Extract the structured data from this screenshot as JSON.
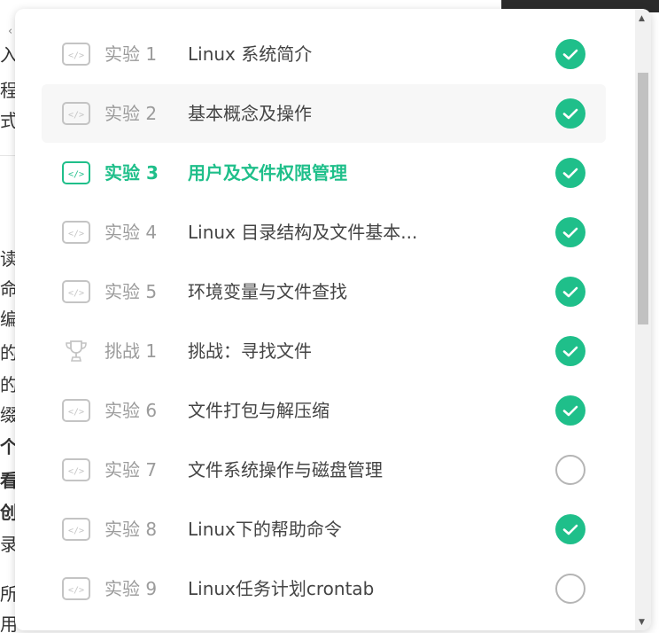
{
  "background": {
    "chars": [
      "入",
      "程",
      "式",
      "读",
      "命",
      "编",
      "的",
      "的",
      "缀",
      "个",
      "看",
      "创",
      "录",
      "所",
      "用"
    ]
  },
  "colors": {
    "accent": "#1fbf8a",
    "complete": "#1fbf8a",
    "incomplete": "#b5b5b5"
  },
  "lessons": [
    {
      "num": "实验 1",
      "title": "Linux 系统简介",
      "icon": "code-icon",
      "status": "complete",
      "active": false,
      "hover": false
    },
    {
      "num": "实验 2",
      "title": "基本概念及操作",
      "icon": "code-icon",
      "status": "complete",
      "active": false,
      "hover": true
    },
    {
      "num": "实验 3",
      "title": "用户及文件权限管理",
      "icon": "code-icon",
      "status": "complete",
      "active": true,
      "hover": false
    },
    {
      "num": "实验 4",
      "title": "Linux 目录结构及文件基本...",
      "icon": "code-icon",
      "status": "complete",
      "active": false,
      "hover": false
    },
    {
      "num": "实验 5",
      "title": "环境变量与文件查找",
      "icon": "code-icon",
      "status": "complete",
      "active": false,
      "hover": false
    },
    {
      "num": "挑战 1",
      "title": "挑战：寻找文件",
      "icon": "trophy-icon",
      "status": "complete",
      "active": false,
      "hover": false
    },
    {
      "num": "实验 6",
      "title": "文件打包与解压缩",
      "icon": "code-icon",
      "status": "complete",
      "active": false,
      "hover": false
    },
    {
      "num": "实验 7",
      "title": "文件系统操作与磁盘管理",
      "icon": "code-icon",
      "status": "incomplete",
      "active": false,
      "hover": false
    },
    {
      "num": "实验 8",
      "title": "Linux下的帮助命令",
      "icon": "code-icon",
      "status": "complete",
      "active": false,
      "hover": false
    },
    {
      "num": "实验 9",
      "title": "Linux任务计划crontab",
      "icon": "code-icon",
      "status": "incomplete",
      "active": false,
      "hover": false
    }
  ]
}
